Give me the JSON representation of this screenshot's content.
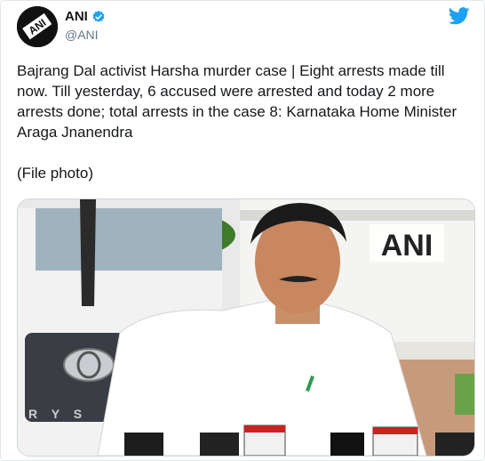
{
  "tweet": {
    "display_name": "ANI",
    "handle": "@ANI",
    "avatar_text": "ANI",
    "text": "Bajrang Dal activist Harsha murder case | Eight arrests made till now. Till yesterday, 6 accused were arrested and today 2 more arrests done; total arrests in the case 8: Karnataka Home Minister Araga Jnanendra\n\n(File photo)",
    "photo_watermark": "ANI",
    "vehicle_badge": "R Y S"
  },
  "icons": {
    "verified": "verified-badge-icon",
    "brand": "twitter-bird-icon"
  },
  "colors": {
    "verified_blue": "#1da1f2",
    "twitter_blue": "#1da1f2",
    "text": "#14171a",
    "secondary": "#657786"
  }
}
